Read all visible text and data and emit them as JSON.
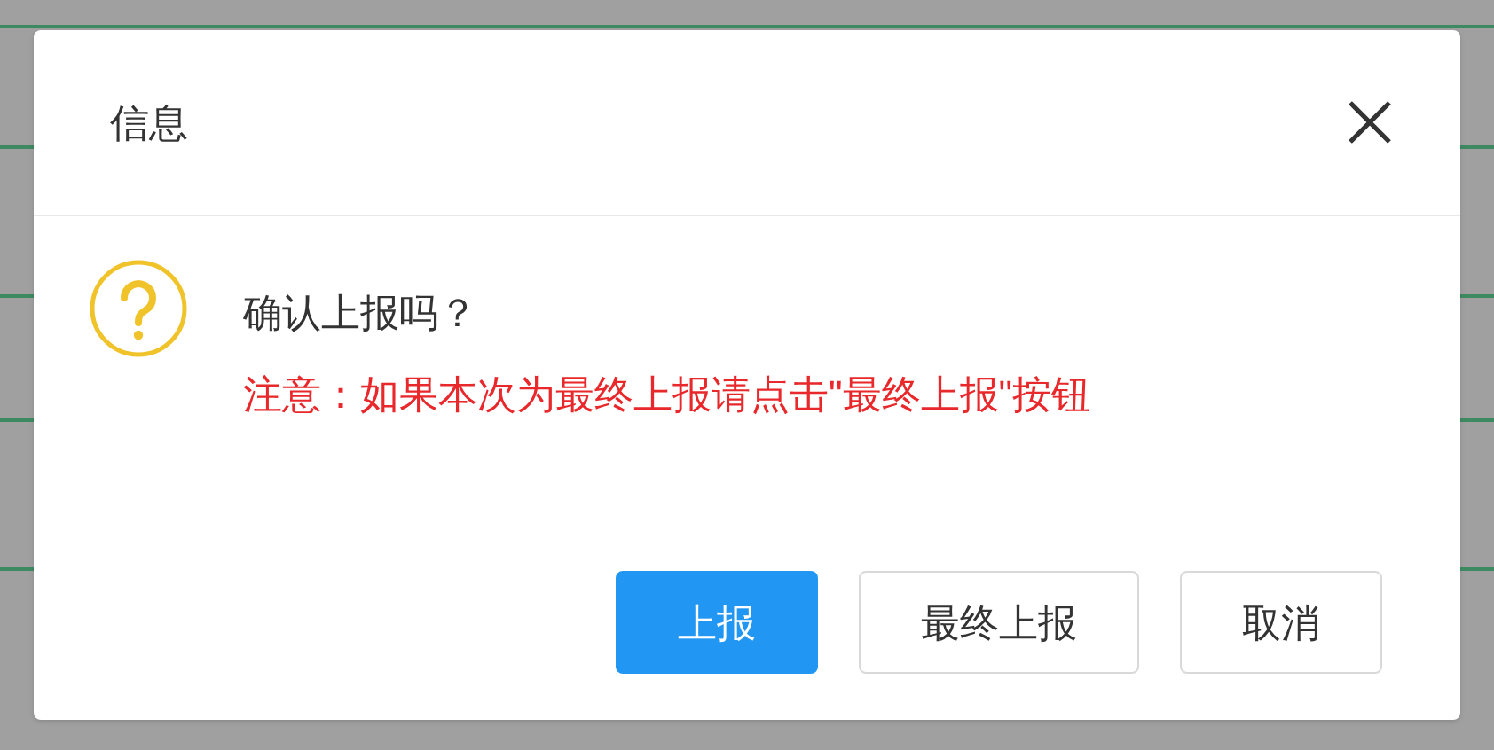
{
  "dialog": {
    "title": "信息",
    "message": {
      "question": "确认上报吗？",
      "warning": "注意：如果本次为最终上报请点击\"最终上报\"按钮"
    },
    "buttons": [
      {
        "label": "上报",
        "kind": "primary"
      },
      {
        "label": "最终上报",
        "kind": "default"
      },
      {
        "label": "取消",
        "kind": "default"
      }
    ]
  }
}
